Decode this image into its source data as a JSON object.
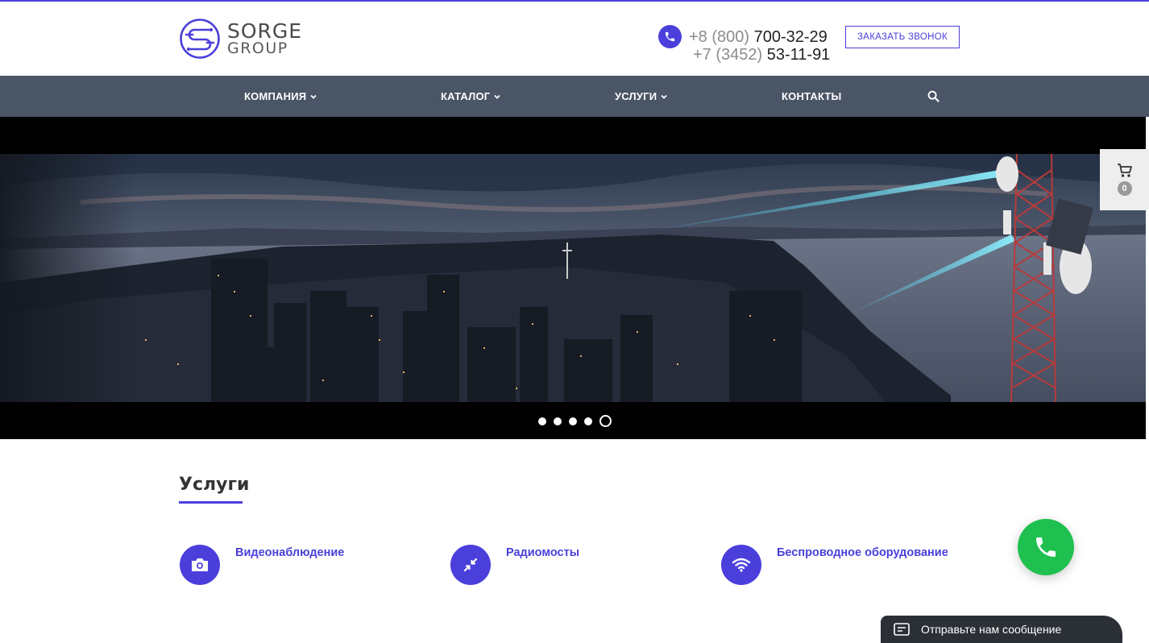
{
  "header": {
    "logo": {
      "word1": "SORGE",
      "word2": "GROUP"
    },
    "phones": [
      {
        "code": "+8 (800)",
        "number": "700-32-29"
      },
      {
        "code": "+7 (3452)",
        "number": "53-11-91"
      }
    ],
    "callback_label": "ЗАКАЗАТЬ ЗВОНОК"
  },
  "nav": {
    "items": [
      {
        "label": "КОМПАНИЯ",
        "has_dropdown": true
      },
      {
        "label": "КАТАЛОГ",
        "has_dropdown": true
      },
      {
        "label": "УСЛУГИ",
        "has_dropdown": true
      },
      {
        "label": "КОНТАКТЫ",
        "has_dropdown": false
      }
    ],
    "search_icon": "search-icon"
  },
  "slider": {
    "slide_count": 5,
    "active_index": 4,
    "scene": "night-city-telecom-tower"
  },
  "cart": {
    "count": "0"
  },
  "services": {
    "title": "Услуги",
    "items": [
      {
        "label": "Видеонаблюдение",
        "icon": "camera-icon"
      },
      {
        "label": "Радиомосты",
        "icon": "arrows-in-icon"
      },
      {
        "label": "Беспроводное оборудование",
        "icon": "wifi-icon"
      }
    ]
  },
  "chat": {
    "label": "Отправьте нам сообщение"
  },
  "colors": {
    "accent": "#4b3fdc",
    "nav_bg": "#4a5566",
    "call_green": "#1fc04f",
    "chat_bg": "#2b2f36"
  }
}
